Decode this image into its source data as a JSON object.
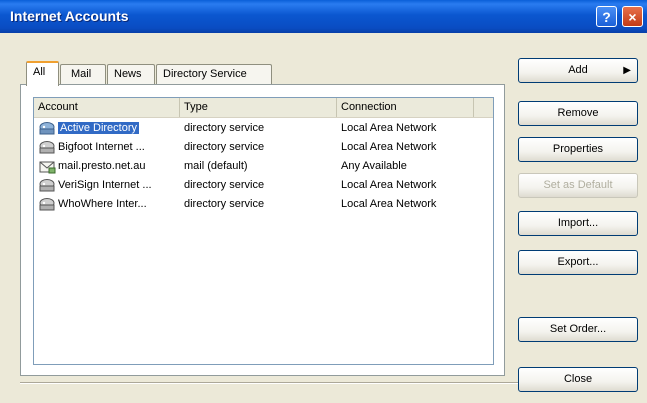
{
  "window": {
    "title": "Internet Accounts",
    "help_glyph": "?",
    "close_glyph": "×"
  },
  "tabs": [
    {
      "label": "All",
      "active": true
    },
    {
      "label": "Mail",
      "active": false
    },
    {
      "label": "News",
      "active": false
    },
    {
      "label": "Directory Service",
      "active": false
    }
  ],
  "list": {
    "columns": [
      "Account",
      "Type",
      "Connection"
    ],
    "rows": [
      {
        "account": "Active Directory",
        "type": "directory service",
        "connection": "Local Area Network",
        "selected": true,
        "icon": "directory-service-icon"
      },
      {
        "account": "Bigfoot Internet ...",
        "type": "directory service",
        "connection": "Local Area Network",
        "selected": false,
        "icon": "directory-service-icon"
      },
      {
        "account": "mail.presto.net.au",
        "type": "mail (default)",
        "connection": "Any Available",
        "selected": false,
        "icon": "mail-account-icon"
      },
      {
        "account": "VeriSign Internet ...",
        "type": "directory service",
        "connection": "Local Area Network",
        "selected": false,
        "icon": "directory-service-icon"
      },
      {
        "account": "WhoWhere Inter...",
        "type": "directory service",
        "connection": "Local Area Network",
        "selected": false,
        "icon": "directory-service-icon"
      }
    ]
  },
  "buttons": {
    "add": "Add",
    "remove": "Remove",
    "properties": "Properties",
    "set_as_default": "Set as Default",
    "import": "Import...",
    "export": "Export...",
    "set_order": "Set Order...",
    "close": "Close"
  },
  "colors": {
    "titlebar": "#0a57d0",
    "selection": "#316ac5",
    "dialog_bg": "#ece9d8"
  }
}
